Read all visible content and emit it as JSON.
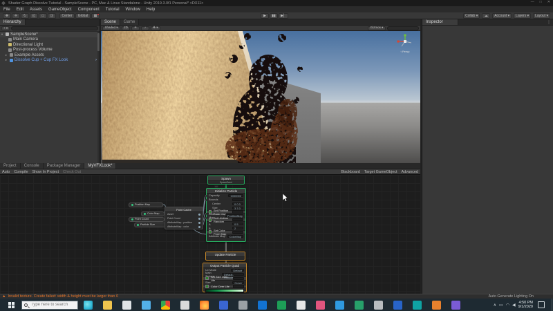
{
  "window": {
    "title": "Shader Graph Dissolve Tutorial - SampleScene - PC, Mac & Linux Standalone - Unity 2019.3.0f1 Personal* <DX11>",
    "minimize": "—",
    "maximize": "□",
    "close": "✕",
    "menus": [
      "File",
      "Edit",
      "Assets",
      "GameObject",
      "Component",
      "Tutorial",
      "Window",
      "Help"
    ]
  },
  "toolbar": {
    "tools": [
      "✥",
      "✛",
      "↻",
      "◱",
      "▭",
      "◲"
    ],
    "pivot": "Center",
    "rotation": "Global",
    "play": "▶",
    "pause": "▮▮",
    "step": "▶▏",
    "collab": "Collab ▾",
    "cloud": "☁",
    "account": "Account ▾",
    "layers": "Layers ▾",
    "layout": "Layout ▾"
  },
  "hierarchy": {
    "tab": "Hierarchy",
    "create": "+ ▾",
    "scene": "SampleScene*",
    "items": [
      "Main Camera",
      "Directional Light",
      "Post-process Volume",
      "Example Assets"
    ],
    "prefab": "Dissolve Cup + Cup FX Look"
  },
  "scene_view": {
    "tab_scene": "Scene",
    "tab_game": "Game",
    "shading": "Shaded ▾",
    "d2": "2D",
    "light": "☀",
    "audio": "♪",
    "fx": "❖ ▾",
    "gizmos": "Gizmos ▾",
    "persp": "‹ Persp"
  },
  "inspector": {
    "tab": "Inspector",
    "menu": "⋮"
  },
  "graph": {
    "tabs": [
      "Project",
      "Console",
      "Package Manager",
      "MyVFXLook*"
    ],
    "toolbar_left": [
      "Auto",
      "Compile",
      "Show In Project",
      "Check Out"
    ],
    "toolbar_right": [
      "Blackboard",
      "Target GameObject",
      "Advanced"
    ],
    "spawn": {
      "title": "Spawn",
      "port": "SpawnEvent"
    },
    "init": {
      "title": "Initialize Particle",
      "rows": [
        {
          "label": "Capacity",
          "value": "1000000"
        },
        {
          "label": "Bounds",
          "value": ""
        },
        {
          "label": "Center",
          "value": "0  0  0",
          "cls": "sub"
        },
        {
          "label": "Size",
          "value": "3  3  3",
          "cls": "sub"
        },
        {
          "label": "Set Position From Map",
          "cls": "block"
        },
        {
          "label": "Attribute Map",
          "value": "PositionMap"
        },
        {
          "label": "Set Lifetime Random",
          "cls": "block"
        },
        {
          "label": "A",
          "value": "0.5"
        },
        {
          "label": "B",
          "value": "2"
        },
        {
          "label": "Set Color From Map",
          "cls": "block"
        },
        {
          "label": "Attribute Map",
          "value": "ColorMap"
        }
      ]
    },
    "update": {
      "title": "Update Particle"
    },
    "output": {
      "title": "Output Particle Quad",
      "rows": [
        {
          "label": "Uv Mode",
          "value": "Default"
        },
        {
          "label": "Main Texture",
          "value": "Default-Particle"
        },
        {
          "label": "Set Size Over Life",
          "cls": "block"
        },
        {
          "label": "Size",
          "value": "Curve"
        },
        {
          "label": "Color Over Life",
          "cls": "block"
        }
      ]
    },
    "properties": [
      "Position Map",
      "Color Map",
      "Point Count",
      "Particle Size"
    ],
    "operator": {
      "title": "Point Cache",
      "rows": [
        "Asset",
        "Point Count",
        "AttributeMap : position",
        "AttributeMap : color"
      ]
    }
  },
  "statusbar": {
    "error": "Invalid texture. Create failed: width & height must be larger than 0",
    "lighting": "Auto Generate Lighting On"
  },
  "taskbar": {
    "search_placeholder": "Type here to search",
    "apps": [
      {
        "name": "edge",
        "bg": "radial-gradient(circle at 40% 40%,#7ee0ea,#2fb9d8 60%,#1a7fa8)"
      },
      {
        "name": "file-explorer",
        "bg": "#f0c54e"
      },
      {
        "name": "store",
        "bg": "#dfe3e6"
      },
      {
        "name": "photos",
        "bg": "#53b0e8"
      },
      {
        "name": "chrome",
        "bg": "conic-gradient(#ea4335 0 120deg,#fbbc05 0 240deg,#34a853 0 360deg)"
      },
      {
        "name": "app-light",
        "bg": "#d9d9d9"
      },
      {
        "name": "firefox",
        "bg": "radial-gradient(circle at 60% 60%,#ffd24a,#ff9640 50%,#e66000)"
      },
      {
        "name": "app-blue",
        "bg": "#3a66d1"
      },
      {
        "name": "app-gray",
        "bg": "#9aa0a4"
      },
      {
        "name": "onedrive",
        "bg": "#1273d2"
      },
      {
        "name": "app-green",
        "bg": "#1d9e57"
      },
      {
        "name": "notepad",
        "bg": "#e6e6e6"
      },
      {
        "name": "app-pink",
        "bg": "#e0557f"
      },
      {
        "name": "vscode",
        "bg": "#2f9ae0"
      },
      {
        "name": "sheets",
        "bg": "#27a06a"
      },
      {
        "name": "settings",
        "bg": "#b9bdc0"
      },
      {
        "name": "app-blue2",
        "bg": "#2864c8"
      },
      {
        "name": "app-teal",
        "bg": "#0fa3a3"
      },
      {
        "name": "app-orange",
        "bg": "#e8812d"
      },
      {
        "name": "app-purple",
        "bg": "#7a5bd6"
      }
    ],
    "tray": [
      "∧",
      "▭",
      "◠",
      "◀"
    ],
    "time": "4:50 PM",
    "date": "9/1/2020"
  }
}
